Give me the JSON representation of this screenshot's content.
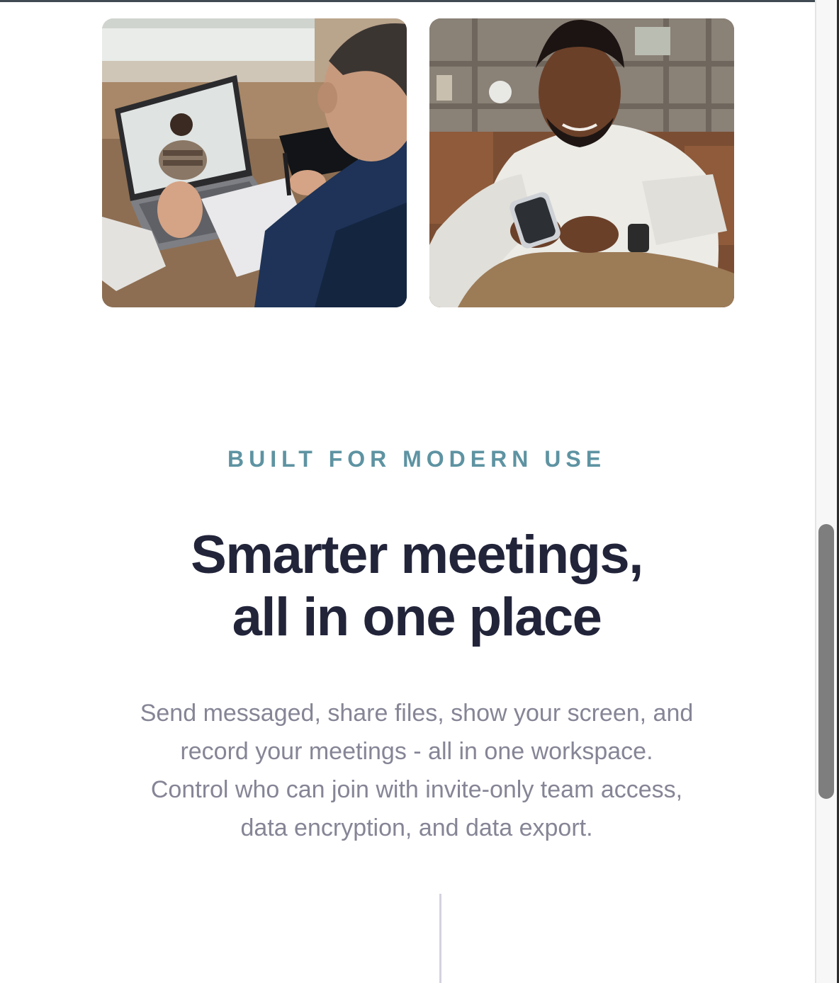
{
  "images": [
    {
      "name": "video-call-laptop-photo"
    },
    {
      "name": "man-using-smartphone-photo"
    }
  ],
  "section": {
    "eyebrow": "BUILT FOR MODERN USE",
    "headline_line1": "Smarter meetings,",
    "headline_line2": "all in one place",
    "body_line1": "Send messaged, share files, show your screen, and",
    "body_line2": "record your meetings - all in one workspace.",
    "body_line3": "Control who can join with invite-only team access,",
    "body_line4": "data encryption, and data export."
  },
  "colors": {
    "eyebrow": "#5e93a2",
    "headline": "#22243a",
    "body": "#858596",
    "divider": "#d3d3de",
    "scrollbar_thumb": "#7e7e7e"
  }
}
